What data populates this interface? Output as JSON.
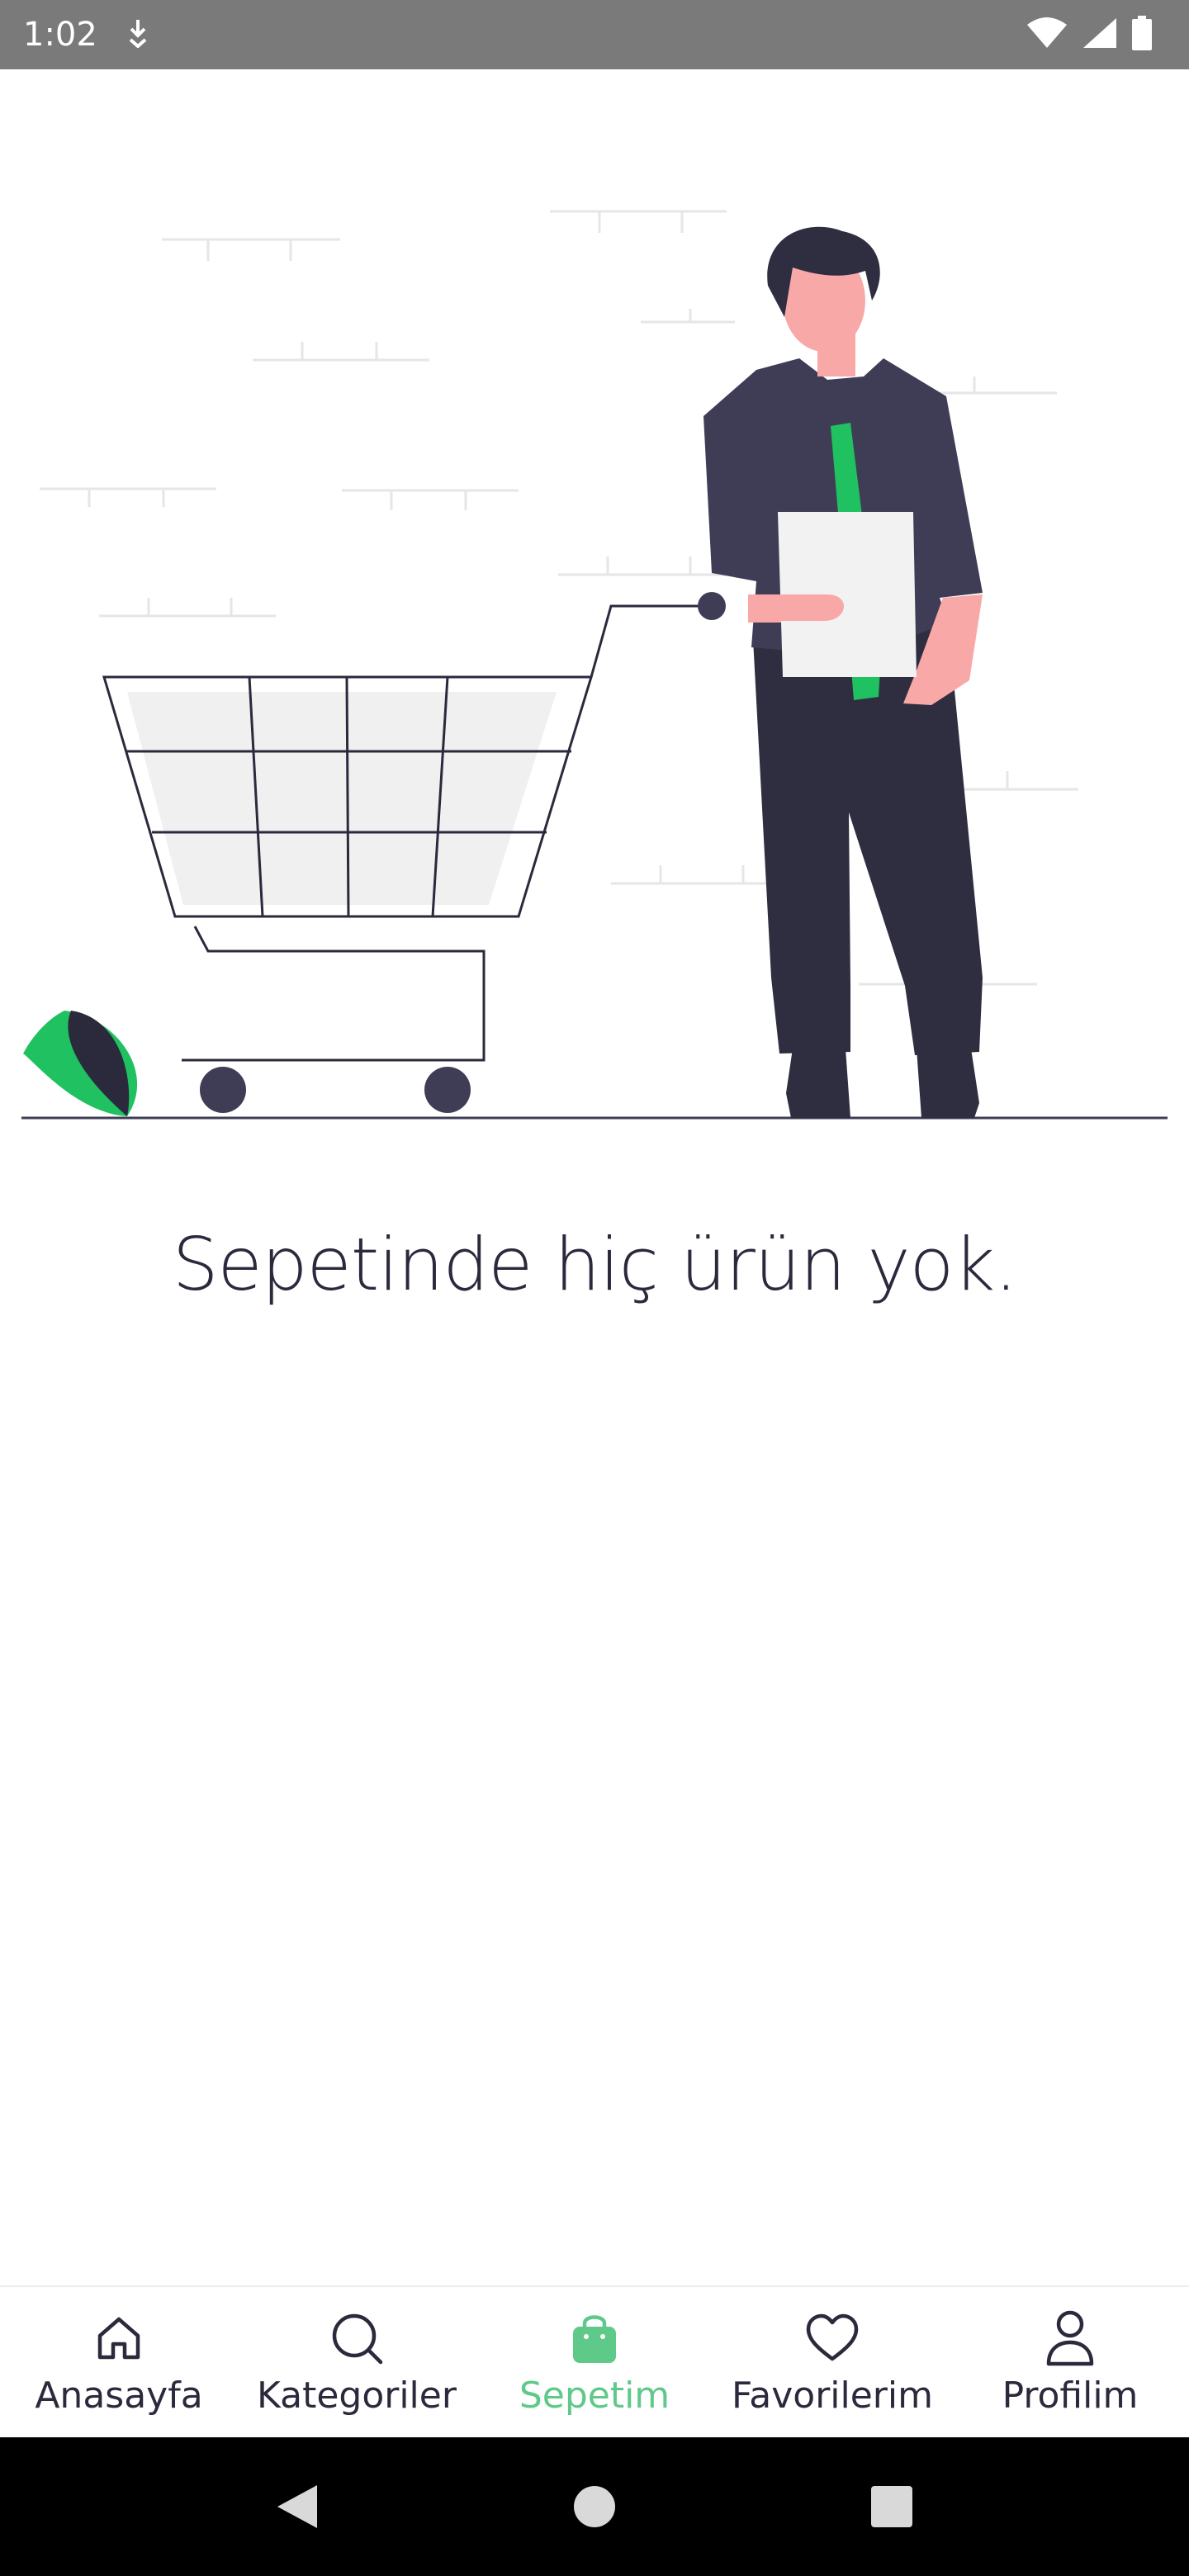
{
  "status_bar": {
    "time": "1:02",
    "icons": [
      "download-indicator-icon",
      "wifi-icon",
      "cellular-signal-icon",
      "battery-icon"
    ]
  },
  "main": {
    "empty_cart_message": "Sepetinde hiç ürün yok."
  },
  "bottom_nav": {
    "items": [
      {
        "label": "Anasayfa",
        "icon": "home-icon",
        "active": false
      },
      {
        "label": "Kategoriler",
        "icon": "search-icon",
        "active": false
      },
      {
        "label": "Sepetim",
        "icon": "shopping-bag-icon",
        "active": true
      },
      {
        "label": "Favorilerim",
        "icon": "heart-icon",
        "active": false
      },
      {
        "label": "Profilim",
        "icon": "user-icon",
        "active": false
      }
    ]
  },
  "system_nav": {
    "icons": [
      "back-icon",
      "home-circle-icon",
      "recents-icon"
    ]
  },
  "colors": {
    "accent": "#5fc98a",
    "text_dark": "#2b2a3d",
    "status_bar_bg": "#7a7a7a",
    "illustration_green": "#1fc160"
  }
}
